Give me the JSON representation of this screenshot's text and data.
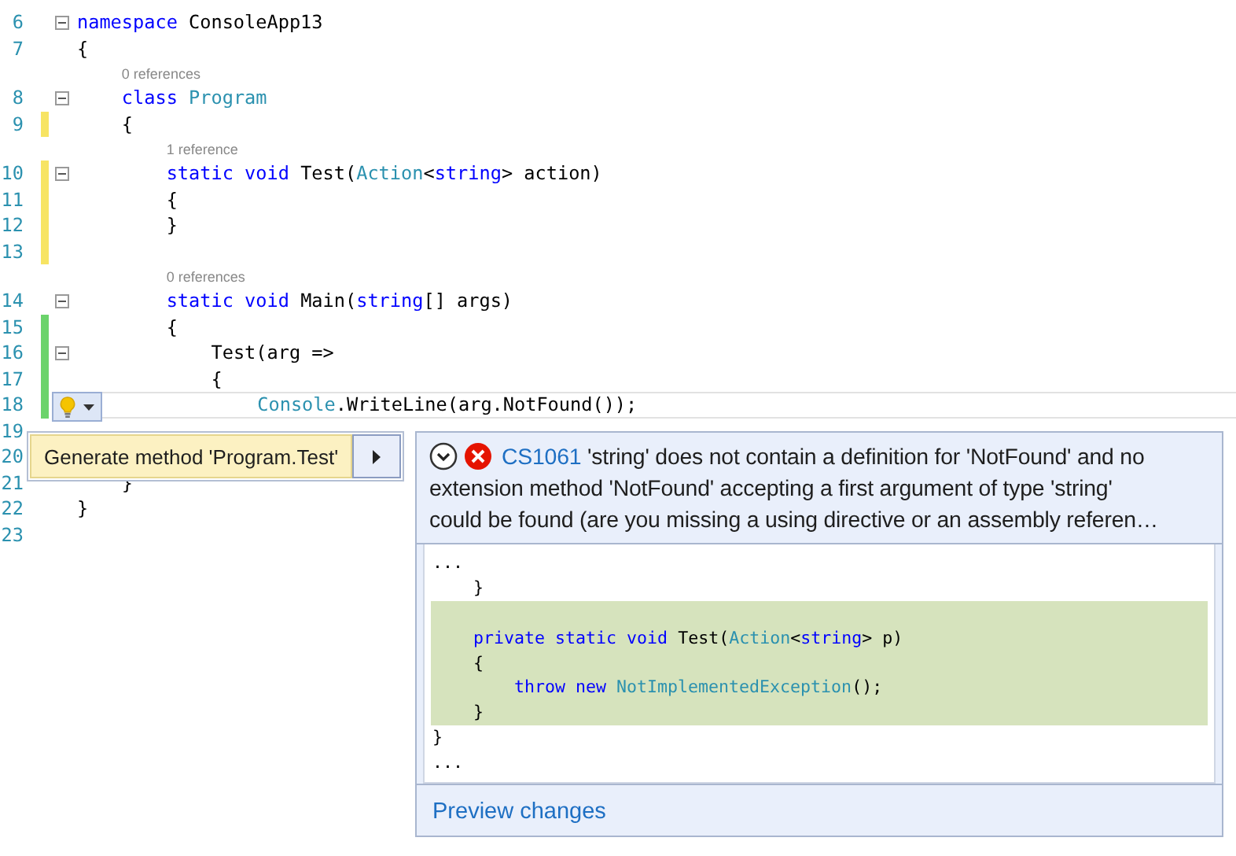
{
  "editor": {
    "lines": [
      {
        "kind": "code",
        "number": "6",
        "fold": true,
        "current": false,
        "tokens": [
          {
            "text": "namespace",
            "kind": "keyword"
          },
          {
            "text": " ConsoleApp13",
            "kind": "plain"
          }
        ]
      },
      {
        "kind": "code",
        "number": "7",
        "fold": false,
        "current": false,
        "tokens": [
          {
            "text": "{",
            "kind": "plain"
          }
        ]
      },
      {
        "kind": "lens",
        "text": "0 references"
      },
      {
        "kind": "code",
        "number": "8",
        "fold": true,
        "current": false,
        "tokens": [
          {
            "text": "    class",
            "kind": "keyword"
          },
          {
            "text": " Program",
            "kind": "type"
          }
        ]
      },
      {
        "kind": "code",
        "number": "9",
        "fold": false,
        "current": false,
        "color": "#f7e463",
        "tokens": [
          {
            "text": "    {",
            "kind": "plain"
          }
        ]
      },
      {
        "kind": "lens",
        "text": "1 reference"
      },
      {
        "kind": "code",
        "number": "10",
        "fold": true,
        "current": false,
        "color": "#f7e463",
        "tokens": [
          {
            "text": "        static",
            "kind": "keyword"
          },
          {
            "text": " void",
            "kind": "keyword"
          },
          {
            "text": " Test(",
            "kind": "plain"
          },
          {
            "text": "Action",
            "kind": "type"
          },
          {
            "text": "<",
            "kind": "plain"
          },
          {
            "text": "string",
            "kind": "keyword"
          },
          {
            "text": "> action)",
            "kind": "plain"
          }
        ]
      },
      {
        "kind": "code",
        "number": "11",
        "fold": false,
        "current": false,
        "color": "#f7e463",
        "tokens": [
          {
            "text": "        {",
            "kind": "plain"
          }
        ]
      },
      {
        "kind": "code",
        "number": "12",
        "fold": false,
        "current": false,
        "color": "#f7e463",
        "tokens": [
          {
            "text": "        }",
            "kind": "plain"
          }
        ]
      },
      {
        "kind": "code",
        "number": "13",
        "fold": false,
        "current": false,
        "color": "#f7e463"
      },
      {
        "kind": "lens",
        "text": "0 references"
      },
      {
        "kind": "code",
        "number": "14",
        "fold": true,
        "current": false,
        "tokens": [
          {
            "text": "        static",
            "kind": "keyword"
          },
          {
            "text": " void",
            "kind": "keyword"
          },
          {
            "text": " Main(",
            "kind": "plain"
          },
          {
            "text": "string",
            "kind": "keyword"
          },
          {
            "text": "[] args)",
            "kind": "plain"
          }
        ]
      },
      {
        "kind": "code",
        "number": "15",
        "fold": false,
        "current": false,
        "color": "#6bd36b",
        "tokens": [
          {
            "text": "        {",
            "kind": "plain"
          }
        ]
      },
      {
        "kind": "code",
        "number": "16",
        "fold": true,
        "current": false,
        "color": "#6bd36b",
        "tokens": [
          {
            "text": "            Test(arg =>",
            "kind": "plain"
          }
        ]
      },
      {
        "kind": "code",
        "number": "17",
        "fold": false,
        "current": false,
        "color": "#6bd36b",
        "tokens": [
          {
            "text": "            {",
            "kind": "plain"
          }
        ]
      },
      {
        "kind": "code",
        "number": "18",
        "fold": false,
        "current": true,
        "color": "#6bd36b",
        "tokens": [
          {
            "text": "                Console",
            "kind": "type"
          },
          {
            "text": ".WriteLine(arg.NotFound());",
            "kind": "plain"
          }
        ]
      },
      {
        "kind": "code",
        "number": "19",
        "fold": false,
        "current": false
      },
      {
        "kind": "code",
        "number": "20",
        "fold": false,
        "current": false
      },
      {
        "kind": "code",
        "number": "21",
        "fold": false,
        "current": false,
        "tokens": [
          {
            "text": "    }",
            "kind": "plain"
          }
        ]
      },
      {
        "kind": "code",
        "number": "22",
        "fold": false,
        "current": false,
        "tokens": [
          {
            "text": "}",
            "kind": "plain"
          }
        ]
      },
      {
        "kind": "code",
        "number": "23",
        "fold": false,
        "current": false
      }
    ]
  },
  "quick_actions": {
    "items": [
      {
        "label": "Generate method 'Program.Test'",
        "selected": true,
        "submenu": true
      }
    ]
  },
  "preview": {
    "error_code": "CS1061",
    "message_lines": [
      "'string' does not contain a definition for 'NotFound' and no",
      "extension method 'NotFound' accepting a first argument of type 'string'",
      "could be found (are you missing a using directive or an assembly referen…"
    ],
    "code": [
      {
        "added": false,
        "tokens": [
          {
            "text": "...",
            "kind": "plain"
          }
        ]
      },
      {
        "added": false,
        "tokens": [
          {
            "text": "    }",
            "kind": "plain"
          }
        ]
      },
      {
        "added": true
      },
      {
        "added": true,
        "tokens": [
          {
            "text": "    private",
            "kind": "keyword"
          },
          {
            "text": " static",
            "kind": "keyword"
          },
          {
            "text": " void",
            "kind": "keyword"
          },
          {
            "text": " Test(",
            "kind": "plain"
          },
          {
            "text": "Action",
            "kind": "type"
          },
          {
            "text": "<",
            "kind": "plain"
          },
          {
            "text": "string",
            "kind": "keyword"
          },
          {
            "text": "> p)",
            "kind": "plain"
          }
        ]
      },
      {
        "added": true,
        "tokens": [
          {
            "text": "    {",
            "kind": "plain"
          }
        ]
      },
      {
        "added": true,
        "tokens": [
          {
            "text": "        throw",
            "kind": "keyword"
          },
          {
            "text": " new",
            "kind": "keyword"
          },
          {
            "text": " NotImplementedException",
            "kind": "type"
          },
          {
            "text": "();",
            "kind": "plain"
          }
        ]
      },
      {
        "added": true,
        "tokens": [
          {
            "text": "    }",
            "kind": "plain"
          }
        ]
      },
      {
        "added": false,
        "tokens": [
          {
            "text": "}",
            "kind": "plain"
          }
        ]
      },
      {
        "added": false,
        "tokens": [
          {
            "text": "...",
            "kind": "plain"
          }
        ]
      }
    ],
    "link": "Preview changes"
  }
}
